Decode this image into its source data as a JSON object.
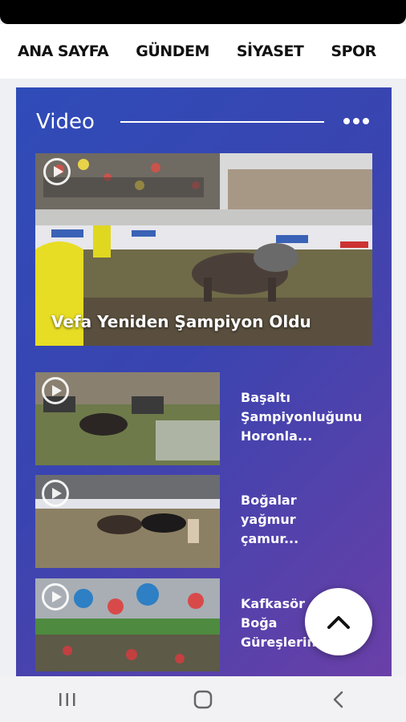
{
  "nav": {
    "items": [
      "ANA SAYFA",
      "GÜNDEM",
      "SİYASET",
      "SPOR"
    ]
  },
  "video_section": {
    "title": "Video",
    "featured": {
      "title": "Vefa Yeniden Şampiyon Oldu"
    },
    "items": [
      {
        "title": "Başaltı\nŞampiyonluğunu\nHoronla..."
      },
      {
        "title": "Boğalar\nyağmur\nçamur..."
      },
      {
        "title": "Kafkasör\nBoğa\nGüreşlerinin"
      }
    ]
  },
  "colors": {
    "panel_gradient_start": "#2f4cb8",
    "panel_gradient_end": "#6c3fa7",
    "text": "#ffffff"
  },
  "icons": {
    "more": "more-dots-icon",
    "play": "play-icon",
    "scroll_top": "chevron-up-icon",
    "system_nav": [
      "recent-apps-icon",
      "home-icon",
      "back-icon"
    ]
  }
}
